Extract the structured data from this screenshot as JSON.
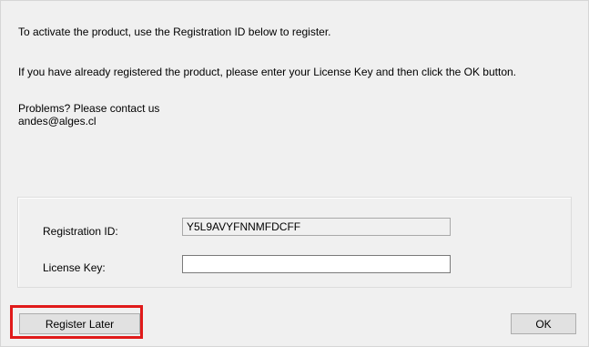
{
  "message": {
    "line1": "To activate the product, use the Registration ID below to register.",
    "line2": "If you have already registered the product, please enter your License Key and then click the OK button.",
    "line3": "Problems? Please contact us",
    "email": "andes@alges.cl"
  },
  "registration": {
    "id_label": "Registration ID:",
    "id_value": "Y5L9AVYFNNMFDCFF",
    "license_label": "License Key:",
    "license_value": ""
  },
  "buttons": {
    "register_later": "Register Later",
    "ok": "OK"
  },
  "colors": {
    "highlight": "#e01a1a",
    "dialog_bg": "#f0f0f0"
  }
}
